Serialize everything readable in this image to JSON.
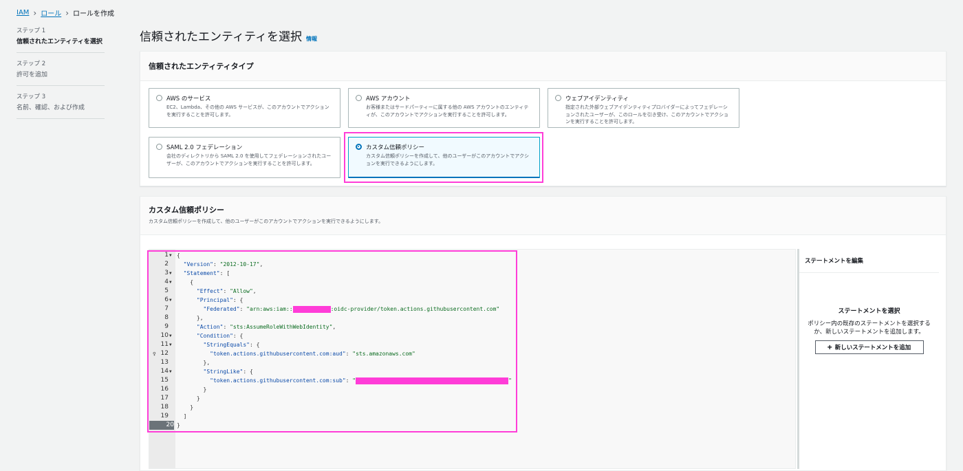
{
  "breadcrumb": {
    "iam": "IAM",
    "role": "ロール",
    "current": "ロールを作成"
  },
  "steps": [
    {
      "num": "ステップ 1",
      "title": "信頼されたエンティティを選択"
    },
    {
      "num": "ステップ 2",
      "title": "許可を追加"
    },
    {
      "num": "ステップ 3",
      "title": "名前、確認、および作成"
    }
  ],
  "page": {
    "title": "信頼されたエンティティを選択",
    "info": "情報"
  },
  "entity_panel": {
    "heading": "信頼されたエンティティタイプ",
    "options": [
      {
        "title": "AWS のサービス",
        "desc": "EC2、Lambda、その他の AWS サービスが、このアカウントでアクションを実行することを許可します。",
        "selected": false
      },
      {
        "title": "AWS アカウント",
        "desc": "お客様またはサードパーティーに属する他の AWS アカウントのエンティティが、このアカウントでアクションを実行することを許可します。",
        "selected": false
      },
      {
        "title": "ウェブアイデンティティ",
        "desc": "指定された外部ウェブアイデンティティプロバイダーによってフェデレーションされたユーザーが、このロールを引き受け、このアカウントでアクションを実行することを許可します。",
        "selected": false
      },
      {
        "title": "SAML 2.0 フェデレーション",
        "desc": "会社のディレクトリから SAML 2.0 を使用してフェデレーションされたユーザーが、このアカウントでアクションを実行することを許可します。",
        "selected": false
      },
      {
        "title": "カスタム信頼ポリシー",
        "desc": "カスタム信頼ポリシーを作成して、他のユーザーがこのアカウントでアクションを実行できるようにします。",
        "selected": true
      }
    ]
  },
  "policy_panel": {
    "heading": "カスタム信頼ポリシー",
    "desc": "カスタム信頼ポリシーを作成して、他のユーザーがこのアカウントでアクションを実行できるようにします。"
  },
  "editor": {
    "current_line": 20,
    "lines": [
      {
        "n": "1",
        "fold": true,
        "text": "{"
      },
      {
        "n": "2",
        "fold": false,
        "text": "  \"Version\": \"2012-10-17\","
      },
      {
        "n": "3",
        "fold": true,
        "text": "  \"Statement\": ["
      },
      {
        "n": "4",
        "fold": true,
        "text": "    {"
      },
      {
        "n": "5",
        "fold": false,
        "text": "      \"Effect\": \"Allow\","
      },
      {
        "n": "6",
        "fold": true,
        "text": "      \"Principal\": {"
      },
      {
        "n": "7",
        "fold": false,
        "text": "        \"Federated\": \"arn:aws:iam::[REDACTED]:oidc-provider/token.actions.githubusercontent.com\""
      },
      {
        "n": "8",
        "fold": false,
        "text": "      },"
      },
      {
        "n": "9",
        "fold": false,
        "text": "      \"Action\": \"sts:AssumeRoleWithWebIdentity\","
      },
      {
        "n": "10",
        "fold": true,
        "text": "      \"Condition\": {"
      },
      {
        "n": "11",
        "fold": true,
        "text": "        \"StringEquals\": {"
      },
      {
        "n": "12",
        "fold": false,
        "text": "          \"token.actions.githubusercontent.com:aud\": \"sts.amazonaws.com\""
      },
      {
        "n": "13",
        "fold": false,
        "text": "        },"
      },
      {
        "n": "14",
        "fold": true,
        "text": "        \"StringLike\": {"
      },
      {
        "n": "15",
        "fold": false,
        "text": "          \"token.actions.githubusercontent.com:sub\": \"[REDACTED2]\""
      },
      {
        "n": "16",
        "fold": false,
        "text": "        }"
      },
      {
        "n": "17",
        "fold": false,
        "text": "      }"
      },
      {
        "n": "18",
        "fold": false,
        "text": "    }"
      },
      {
        "n": "19",
        "fold": false,
        "text": "  ]"
      },
      {
        "n": "20",
        "fold": false,
        "text": "}"
      }
    ],
    "redaction_color": "#ff3dd8"
  },
  "statement_panel": {
    "heading": "ステートメントを編集",
    "select_title": "ステートメントを選択",
    "select_desc": "ポリシー内の既存のステートメントを選択するか、新しいステートメントを追加します。",
    "add_button": "新しいステートメントを追加"
  },
  "colors": {
    "accent": "#0073bb",
    "highlight": "#ff3dd8"
  }
}
